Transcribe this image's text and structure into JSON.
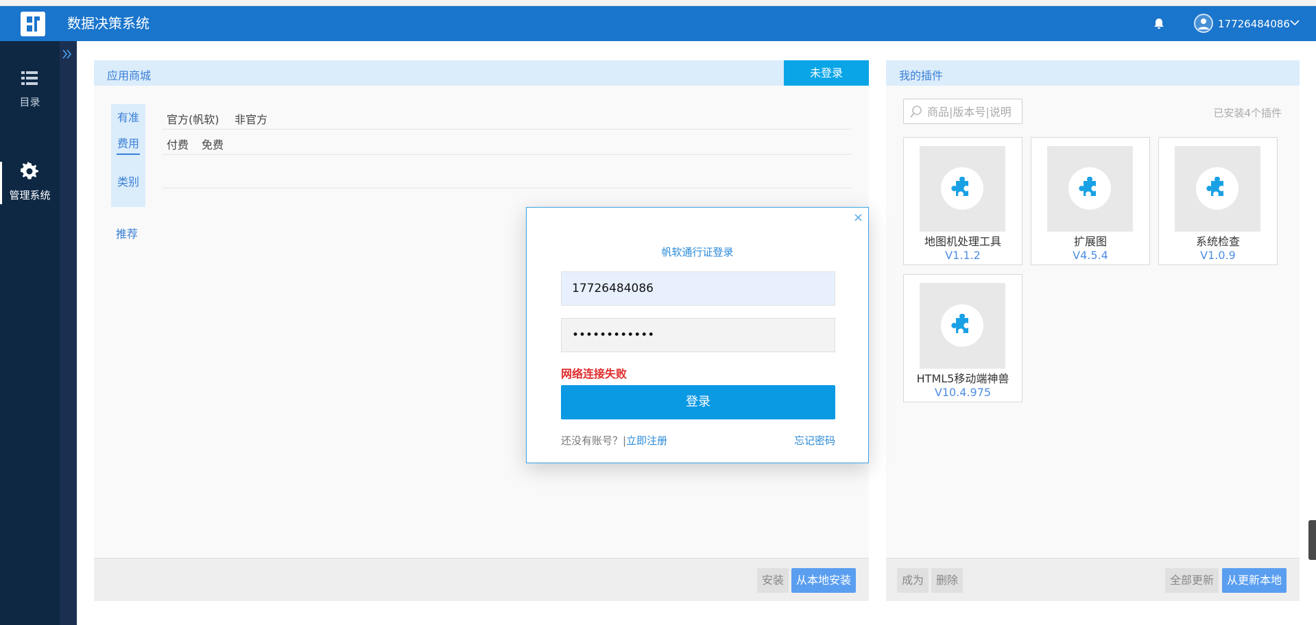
{
  "header": {
    "app_title": "数据决策系统",
    "username": "17726484086"
  },
  "sidebar": {
    "items": [
      {
        "label": "目录",
        "icon": "list-icon"
      },
      {
        "label": "管理系统",
        "icon": "gear-icon"
      }
    ]
  },
  "store": {
    "title": "应用商城",
    "login_tab": "未登录",
    "filter_keys": [
      "有准",
      "费用",
      "类别"
    ],
    "recommend": "推荐",
    "source_options": [
      "官方(帆软)",
      "非官方"
    ],
    "fee_options": [
      "付费",
      "免费"
    ],
    "install_button": "安装",
    "local_install_button": "从本地安装"
  },
  "plugins": {
    "title": "我的插件",
    "search_placeholder": "商品|版本号|说明",
    "installed_count": "已安装4个插件",
    "items": [
      {
        "name": "地图机处理工具",
        "version": "V1.1.2"
      },
      {
        "name": "扩展图",
        "version": "V4.5.4"
      },
      {
        "name": "系统检查",
        "version": "V1.0.9"
      },
      {
        "name": "HTML5移动端神兽",
        "version": "V10.4.975"
      }
    ],
    "success_button": "成为",
    "delete_button": "删除",
    "update_all_button": "全部更新",
    "update_local_button": "从更新本地"
  },
  "login_modal": {
    "title": "帆软通行证登录",
    "username_value": "17726484086",
    "password_value": "••••••••••••",
    "error": "网络连接失败",
    "login_button": "登录",
    "no_account": "还没有账号？|",
    "register": "立即注册",
    "forgot": "忘记密码",
    "close": "×"
  },
  "colors": {
    "topbar": "#1a75cc",
    "sidebar": "#0e2844",
    "accent": "#0aa5e7",
    "error": "#e02c2c"
  }
}
